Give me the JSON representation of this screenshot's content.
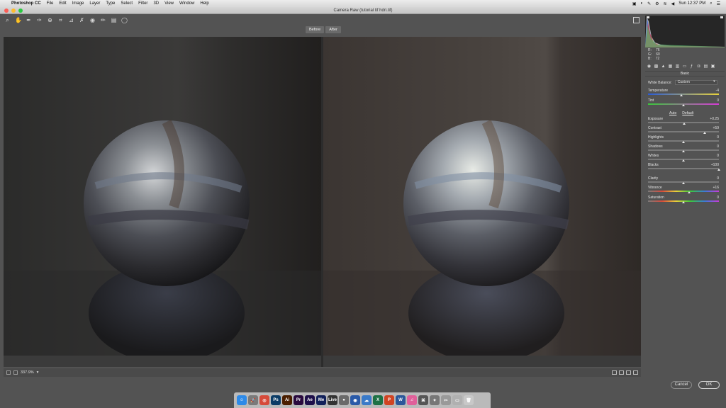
{
  "menubar": {
    "app": "Photoshop CC",
    "items": [
      "File",
      "Edit",
      "Image",
      "Layer",
      "Type",
      "Select",
      "Filter",
      "3D",
      "View",
      "Window",
      "Help"
    ],
    "clock": "Sun 12:37 PM"
  },
  "window": {
    "title": "Camera Raw (tutorial tif hdri.tif)"
  },
  "preview": {
    "before_label": "Before",
    "after_label": "After",
    "zoom": "337.9%"
  },
  "readout": {
    "r_label": "R:",
    "r": "76",
    "g_label": "G:",
    "g": "60",
    "b_label": "B:",
    "b": "72"
  },
  "panel": {
    "name": "Basic",
    "white_balance_label": "White Balance:",
    "white_balance_value": "Custom",
    "auto_label": "Auto",
    "default_label": "Default"
  },
  "sliders": [
    {
      "label": "Temperature",
      "value": "-4",
      "pos": 0.47
    },
    {
      "label": "Tint",
      "value": "0",
      "pos": 0.5
    },
    {
      "label": "Exposure",
      "value": "+0.25",
      "pos": 0.51
    },
    {
      "label": "Contrast",
      "value": "+59",
      "pos": 0.8
    },
    {
      "label": "Highlights",
      "value": "0",
      "pos": 0.5
    },
    {
      "label": "Shadows",
      "value": "0",
      "pos": 0.5
    },
    {
      "label": "Whites",
      "value": "0",
      "pos": 0.5
    },
    {
      "label": "Blacks",
      "value": "+100",
      "pos": 1.0
    },
    {
      "label": "Clarity",
      "value": "0",
      "pos": 0.5
    },
    {
      "label": "Vibrance",
      "value": "+16",
      "pos": 0.58
    },
    {
      "label": "Saturation",
      "value": "0",
      "pos": 0.5
    }
  ],
  "buttons": {
    "cancel": "Cancel",
    "ok": "OK"
  },
  "colors": {
    "close": "#fc5f57",
    "minimize": "#fdbc2e",
    "zoom": "#28c940",
    "panel_bg": "#535353"
  },
  "dock": [
    {
      "name": "finder",
      "glyph": "☺",
      "color": "#2d8ae8"
    },
    {
      "name": "launchpad",
      "glyph": "🚀",
      "color": "#7a7a7a"
    },
    {
      "name": "chrome",
      "glyph": "◎",
      "color": "#d64a3a"
    },
    {
      "name": "photoshop",
      "glyph": "Ps",
      "color": "#0c3c66"
    },
    {
      "name": "illustrator",
      "glyph": "Ai",
      "color": "#4a1e00"
    },
    {
      "name": "premiere",
      "glyph": "Pr",
      "color": "#2a0a3e"
    },
    {
      "name": "after-effects",
      "glyph": "Ae",
      "color": "#1e0f4a"
    },
    {
      "name": "media-encoder",
      "glyph": "Me",
      "color": "#12215a"
    },
    {
      "name": "live",
      "glyph": "Live",
      "color": "#333333"
    },
    {
      "name": "app-1",
      "glyph": "●",
      "color": "#6a6a6a"
    },
    {
      "name": "app-2",
      "glyph": "◉",
      "color": "#2a5aa8"
    },
    {
      "name": "app-3",
      "glyph": "☁",
      "color": "#3a7ac8"
    },
    {
      "name": "excel",
      "glyph": "X",
      "color": "#1e7145"
    },
    {
      "name": "powerpoint",
      "glyph": "P",
      "color": "#d04423"
    },
    {
      "name": "word",
      "glyph": "W",
      "color": "#2b579a"
    },
    {
      "name": "itunes",
      "glyph": "♫",
      "color": "#e0609a"
    },
    {
      "name": "app-4",
      "glyph": "⌘",
      "color": "#555555"
    },
    {
      "name": "app-5",
      "glyph": "✦",
      "color": "#777777"
    },
    {
      "name": "app-6",
      "glyph": "✂",
      "color": "#999999"
    },
    {
      "name": "app-7",
      "glyph": "▭",
      "color": "#b0b0b0"
    },
    {
      "name": "trash",
      "glyph": "🗑",
      "color": "#c8c8c8"
    }
  ]
}
